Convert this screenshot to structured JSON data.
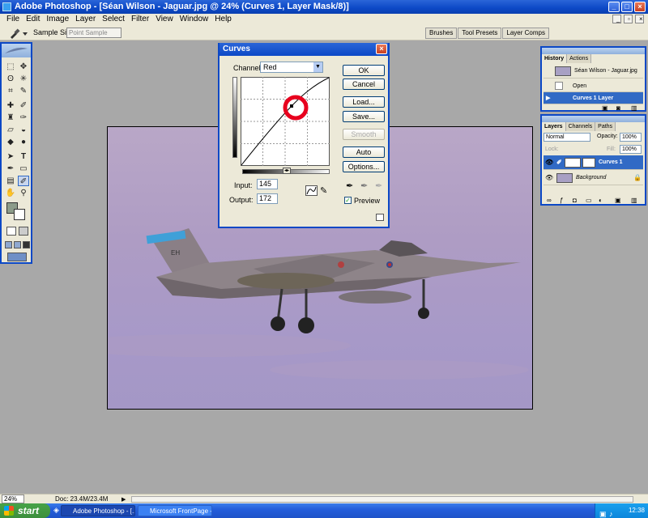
{
  "window": {
    "title": "Adobe Photoshop - [Séan Wilson - Jaguar.jpg @ 24% (Curves 1, Layer Mask/8)]"
  },
  "menu": [
    "File",
    "Edit",
    "Image",
    "Layer",
    "Select",
    "Filter",
    "View",
    "Window",
    "Help"
  ],
  "options_bar": {
    "sample_size_label": "Sample Size:",
    "sample_size_value": "Point Sample",
    "palette_tabs": [
      "Brushes",
      "Tool Presets",
      "Layer Comps"
    ]
  },
  "curves": {
    "title": "Curves",
    "channel_label": "Channel:",
    "channel_value": "Red",
    "buttons": {
      "ok": "OK",
      "cancel": "Cancel",
      "load": "Load...",
      "save": "Save...",
      "smooth": "Smooth",
      "auto": "Auto",
      "options": "Options..."
    },
    "input_label": "Input:",
    "input_value": "145",
    "output_label": "Output:",
    "output_value": "172",
    "preview_label": "Preview",
    "preview_checked": true
  },
  "history": {
    "tabs": [
      "History",
      "Actions"
    ],
    "snapshot": "Séan Wilson - Jaguar.jpg",
    "items": [
      "Open",
      "Curves 1 Layer"
    ],
    "selected_index": 1
  },
  "layers": {
    "tabs": [
      "Layers",
      "Channels",
      "Paths"
    ],
    "blend_mode": "Normal",
    "opacity_label": "Opacity:",
    "opacity_value": "100%",
    "lock_label": "Lock:",
    "fill_label": "Fill:",
    "fill_value": "100%",
    "items": [
      "Curves 1",
      "Background"
    ]
  },
  "aircraft": {
    "code": "EH"
  },
  "status": {
    "zoom": "24%",
    "doc": "Doc: 23.4M/23.4M"
  },
  "taskbar": {
    "start": "start",
    "tasks": [
      "Adobe Photoshop - [...",
      "Microsoft FrontPage -..."
    ],
    "clock": "12:38"
  },
  "colors": {
    "xp_blue": "#0c48c6",
    "selection": "#316ac5",
    "curve_marker": "#e8001e",
    "sky": "#b1a1c7"
  }
}
